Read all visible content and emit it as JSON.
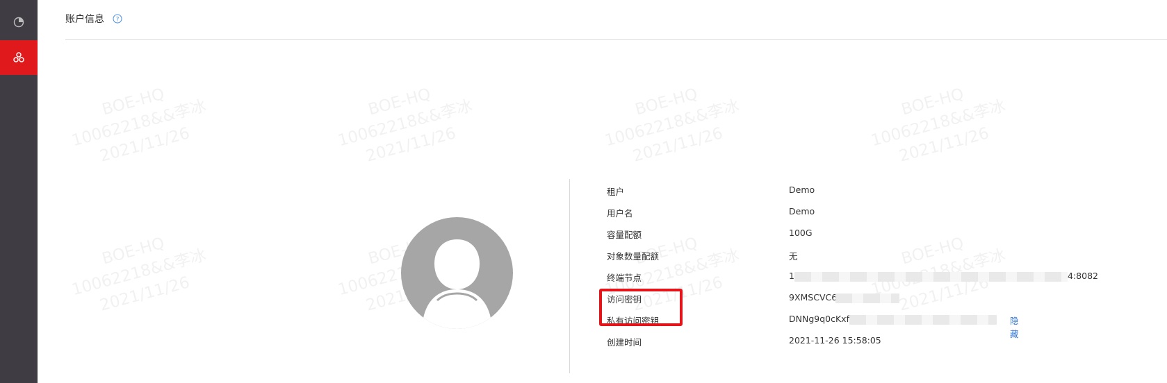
{
  "header": {
    "title": "账户信息",
    "help_icon": "question-circle-icon"
  },
  "rail": {
    "items": [
      {
        "icon": "pie-chart-icon",
        "active": false
      },
      {
        "icon": "cluster-nodes-icon",
        "active": true
      }
    ],
    "colors": {
      "background": "#3f3d43",
      "active": "#e0191c"
    }
  },
  "watermark": {
    "line1": "BOE-HQ",
    "line2": "10062218&&李冰",
    "line3": "2021/11/26"
  },
  "account": {
    "rows": [
      {
        "label": "租户",
        "value": "Demo"
      },
      {
        "label": "用户名",
        "value": "Demo"
      },
      {
        "label": "容量配额",
        "value": "100G"
      },
      {
        "label": "对象数量配额",
        "value": "无"
      },
      {
        "label": "终端节点",
        "value_prefix": "1",
        "value_suffix": "4:8082"
      },
      {
        "label": "访问密钥",
        "value": "9XMSCVC6"
      },
      {
        "label": "私有访问密钥",
        "value": "DNNg9q0cKxf0",
        "action": "隐藏"
      },
      {
        "label": "创建时间",
        "value": "2021-11-26 15:58:05"
      }
    ]
  },
  "colors": {
    "link": "#3a7bd5",
    "highlight": "#e4141b"
  }
}
